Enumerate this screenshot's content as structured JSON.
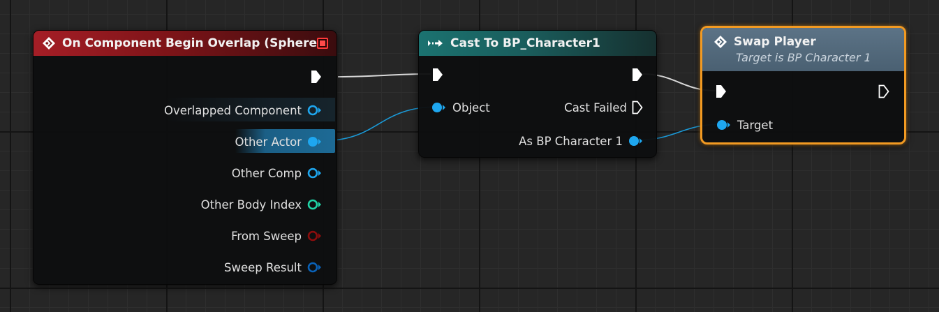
{
  "nodes": {
    "event": {
      "title": "On Component Begin Overlap (Sphere)",
      "pins": [
        {
          "label": "Overlapped Component",
          "type": "object"
        },
        {
          "label": "Other Actor",
          "type": "object"
        },
        {
          "label": "Other Comp",
          "type": "object"
        },
        {
          "label": "Other Body Index",
          "type": "integer"
        },
        {
          "label": "From Sweep",
          "type": "boolean"
        },
        {
          "label": "Sweep Result",
          "type": "struct"
        }
      ]
    },
    "cast": {
      "title": "Cast To BP_Character1",
      "input_pin": "Object",
      "cast_failed_pin": "Cast Failed",
      "output_pin": "As BP Character 1"
    },
    "swap": {
      "title": "Swap Player",
      "subtitle": "Target is BP Character 1",
      "target_pin": "Target"
    }
  },
  "colors": {
    "object_pin": "#1ea7f0",
    "integer_pin": "#20d6a8",
    "boolean_pin": "#8c0d0d",
    "struct_pin": "#0a62b8",
    "event_header": "#a51e26",
    "cast_header": "#1b7270",
    "function_header": "#5c7386",
    "selection_outline": "#f29a22"
  }
}
